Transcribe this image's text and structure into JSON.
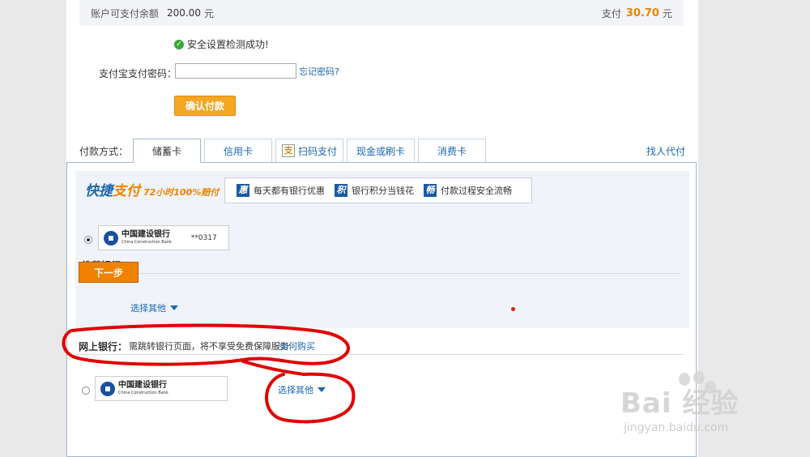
{
  "balance": {
    "label": "账户可支付余额",
    "amount": "200.00",
    "unit": "元",
    "pay_label": "支付",
    "pay_amount": "30.70",
    "pay_unit": "元"
  },
  "security": {
    "check_text": "安全设置检测成功!"
  },
  "password": {
    "label": "支付宝支付密码：",
    "value": "",
    "forgot_link": "忘记密码?"
  },
  "confirm_button": "确认付款",
  "payment": {
    "method_label": "付款方式：",
    "tabs": [
      {
        "label": "储蓄卡",
        "active": true
      },
      {
        "label": "信用卡",
        "active": false
      },
      {
        "label": "扫码支付",
        "active": false,
        "icon": "支"
      },
      {
        "label": "现金或刷卡",
        "active": false
      },
      {
        "label": "消费卡",
        "active": false
      }
    ],
    "agent_link": "找人代付"
  },
  "quick_pay": {
    "logo_a": "快捷",
    "logo_b": "支付",
    "logo_tag": "72小时100%赔付",
    "promos": [
      {
        "icon": "惠",
        "text": "每天都有银行优惠"
      },
      {
        "icon": "积",
        "text": "银行积分当钱花"
      },
      {
        "icon": "畅",
        "text": "付款过程安全流畅"
      }
    ],
    "saved_card": {
      "bank_cn": "中国建设银行",
      "bank_en": "China Construction Bank",
      "card_no": "**0317",
      "selected": true
    },
    "recommended_label": "推荐银行：",
    "choose_other": "选择其他"
  },
  "online_bank": {
    "label": "网上银行：",
    "note": "需跳转银行页面，将不享受免费保障服务",
    "link": "如何购买",
    "bank_cn": "中国建设银行",
    "bank_en": "China Construction Bank",
    "choose_other": "选择其他",
    "selected": false
  },
  "next_button": "下一步",
  "watermark": {
    "brand": "Bai  经验",
    "url": "jingyan.baidu.com"
  },
  "colors": {
    "accent_orange": "#f08200",
    "link_blue": "#1a66b3",
    "annotation_red": "#e00000"
  }
}
